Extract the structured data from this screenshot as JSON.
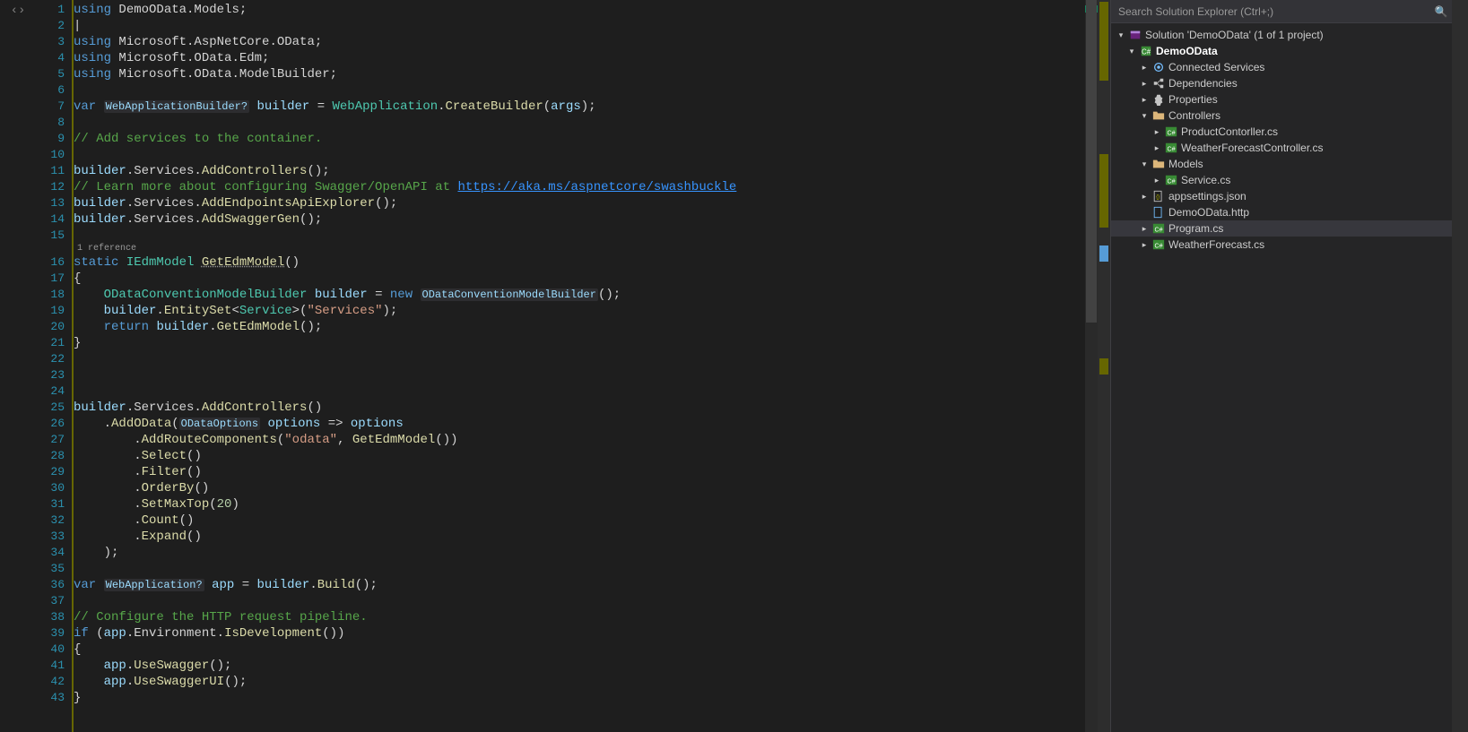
{
  "editor": {
    "codeLens": "1 reference",
    "lines": [
      {
        "n": 1,
        "html": "<span class='collapse'>▾</span><span class='k'>using</span> <span class='p'>DemoOData.Models;</span>"
      },
      {
        "n": 2,
        "html": "<span class='p'>|</span>"
      },
      {
        "n": 3,
        "html": "<span class='k'>using</span> <span class='p'>Microsoft.AspNetCore.OData;</span>"
      },
      {
        "n": 4,
        "html": "<span class='k'>using</span> <span class='p'>Microsoft.OData.Edm;</span>"
      },
      {
        "n": 5,
        "html": "<span class='k'>using</span> <span class='p'>Microsoft.OData.ModelBuilder;</span>"
      },
      {
        "n": 6,
        "html": ""
      },
      {
        "n": 7,
        "html": "<span class='k'>var</span> <span class='param-hint'>WebApplicationBuilder?</span> <span class='v'>builder</span> <span class='p'>=</span> <span class='t'>WebApplication</span><span class='p'>.</span><span class='m'>CreateBuilder</span><span class='p'>(</span><span class='v'>args</span><span class='p'>);</span>"
      },
      {
        "n": 8,
        "html": ""
      },
      {
        "n": 9,
        "html": "<span class='c'>// Add services to the container.</span>"
      },
      {
        "n": 10,
        "html": ""
      },
      {
        "n": 11,
        "html": "<span class='v'>builder</span><span class='p'>.Services.</span><span class='m'>AddControllers</span><span class='p'>();</span>"
      },
      {
        "n": 12,
        "html": "<span class='c'>// Learn more about configuring Swagger/OpenAPI at </span><span class='u'>https://aka.ms/aspnetcore/swashbuckle</span>"
      },
      {
        "n": 13,
        "html": "<span class='v'>builder</span><span class='p'>.Services.</span><span class='m'>AddEndpointsApiExplorer</span><span class='p'>();</span>"
      },
      {
        "n": 14,
        "html": "<span class='v'>builder</span><span class='p'>.Services.</span><span class='m'>AddSwaggerGen</span><span class='p'>();</span>"
      },
      {
        "n": 15,
        "html": ""
      },
      {
        "codelens": true
      },
      {
        "n": 16,
        "html": "<span class='collapse'>▾</span><span class='k'>static</span> <span class='t'>IEdmModel</span> <span class='m' style='text-decoration:underline dotted #999;'>GetEdmModel</span><span class='p'>()</span>"
      },
      {
        "n": 17,
        "html": "<span class='p'>{</span>"
      },
      {
        "n": 18,
        "html": "    <span class='t'>ODataConventionModelBuilder</span> <span class='v'>builder</span> <span class='p'>=</span> <span class='k'>new</span> <span class='param-hint'>ODataConventionModelBuilder</span><span class='p'>();</span>"
      },
      {
        "n": 19,
        "html": "    <span class='v'>builder</span><span class='p'>.</span><span class='m'>EntitySet</span><span class='p'>&lt;</span><span class='t'>Service</span><span class='p'>&gt;(</span><span class='s'>\"Services\"</span><span class='p'>);</span>"
      },
      {
        "n": 20,
        "html": "    <span class='k'>return</span> <span class='v'>builder</span><span class='p'>.</span><span class='m'>GetEdmModel</span><span class='p'>();</span>"
      },
      {
        "n": 21,
        "html": "<span class='p'>}</span>"
      },
      {
        "n": 22,
        "html": ""
      },
      {
        "n": 23,
        "html": ""
      },
      {
        "n": 24,
        "html": ""
      },
      {
        "n": 25,
        "html": "<span class='v'>builder</span><span class='p'>.Services.</span><span class='m'>AddControllers</span><span class='p'>()</span>"
      },
      {
        "n": 26,
        "html": "    <span class='p'>.</span><span class='m'>AddOData</span><span class='p'>(</span><span class='param-hint'>ODataOptions</span> <span class='v'>options</span> <span class='p'>=&gt;</span> <span class='v'>options</span>"
      },
      {
        "n": 27,
        "html": "        <span class='p'>.</span><span class='m'>AddRouteComponents</span><span class='p'>(</span><span class='s'>\"odata\"</span><span class='p'>, </span><span class='m'>GetEdmModel</span><span class='p'>())</span>"
      },
      {
        "n": 28,
        "html": "        <span class='p'>.</span><span class='m'>Select</span><span class='p'>()</span>"
      },
      {
        "n": 29,
        "html": "        <span class='p'>.</span><span class='m'>Filter</span><span class='p'>()</span>"
      },
      {
        "n": 30,
        "html": "        <span class='p'>.</span><span class='m'>OrderBy</span><span class='p'>()</span>"
      },
      {
        "n": 31,
        "html": "        <span class='p'>.</span><span class='m'>SetMaxTop</span><span class='p'>(</span><span class='n'>20</span><span class='p'>)</span>"
      },
      {
        "n": 32,
        "html": "        <span class='p'>.</span><span class='m'>Count</span><span class='p'>()</span>"
      },
      {
        "n": 33,
        "html": "        <span class='p'>.</span><span class='m'>Expand</span><span class='p'>()</span>"
      },
      {
        "n": 34,
        "html": "    <span class='p'>);</span>"
      },
      {
        "n": 35,
        "html": ""
      },
      {
        "n": 36,
        "html": "<span class='k'>var</span> <span class='param-hint'>WebApplication?</span> <span class='v'>app</span> <span class='p'>=</span> <span class='v'>builder</span><span class='p'>.</span><span class='m'>Build</span><span class='p'>();</span>"
      },
      {
        "n": 37,
        "html": ""
      },
      {
        "n": 38,
        "html": "<span class='c'>// Configure the HTTP request pipeline.</span>"
      },
      {
        "n": 39,
        "html": "<span class='collapse'>▾</span><span class='k'>if</span> <span class='p'>(</span><span class='v'>app</span><span class='p'>.Environment.</span><span class='m'>IsDevelopment</span><span class='p'>())</span>"
      },
      {
        "n": 40,
        "html": "<span class='p'>{</span>"
      },
      {
        "n": 41,
        "html": "    <span class='v'>app</span><span class='p'>.</span><span class='m'>UseSwagger</span><span class='p'>();</span>"
      },
      {
        "n": 42,
        "html": "    <span class='v'>app</span><span class='p'>.</span><span class='m'>UseSwaggerUI</span><span class='p'>();</span>"
      },
      {
        "n": 43,
        "html": "<span class='p'>}</span>"
      }
    ]
  },
  "solution": {
    "searchPlaceholder": "Search Solution Explorer (Ctrl+;)",
    "tree": [
      {
        "ind": 0,
        "arrow": "▾",
        "icon": "sln",
        "label": "Solution 'DemoOData' (1 of 1 project)"
      },
      {
        "ind": 1,
        "arrow": "▾",
        "icon": "proj",
        "label": "DemoOData",
        "bold": true
      },
      {
        "ind": 2,
        "arrow": "▸",
        "icon": "conn",
        "label": "Connected Services"
      },
      {
        "ind": 2,
        "arrow": "▸",
        "icon": "dep",
        "label": "Dependencies"
      },
      {
        "ind": 2,
        "arrow": "▸",
        "icon": "prop",
        "label": "Properties"
      },
      {
        "ind": 2,
        "arrow": "▾",
        "icon": "folder",
        "label": "Controllers"
      },
      {
        "ind": 3,
        "arrow": "▸",
        "icon": "cs",
        "label": "ProductContorller.cs"
      },
      {
        "ind": 3,
        "arrow": "▸",
        "icon": "cs",
        "label": "WeatherForecastController.cs"
      },
      {
        "ind": 2,
        "arrow": "▾",
        "icon": "folder",
        "label": "Models"
      },
      {
        "ind": 3,
        "arrow": "▸",
        "icon": "cs",
        "label": "Service.cs"
      },
      {
        "ind": 2,
        "arrow": "▸",
        "icon": "json",
        "label": "appsettings.json"
      },
      {
        "ind": 2,
        "arrow": "",
        "icon": "http",
        "label": "DemoOData.http"
      },
      {
        "ind": 2,
        "arrow": "▸",
        "icon": "cs",
        "label": "Program.cs",
        "selected": true
      },
      {
        "ind": 2,
        "arrow": "▸",
        "icon": "cs",
        "label": "WeatherForecast.cs"
      }
    ]
  }
}
